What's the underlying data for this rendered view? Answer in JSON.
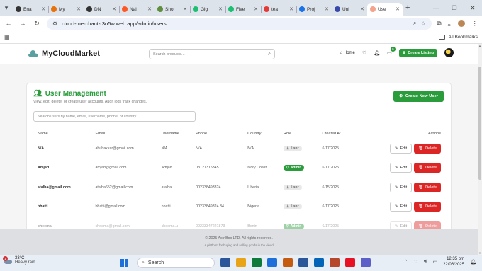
{
  "browser": {
    "tabs": [
      {
        "label": "Ena",
        "color": "#333333"
      },
      {
        "label": "My",
        "color": "#e8710a"
      },
      {
        "label": "DN",
        "color": "#333333"
      },
      {
        "label": "Nai",
        "color": "#ff5722"
      },
      {
        "label": "Sho",
        "color": "#5e8e3e"
      },
      {
        "label": "Gig",
        "color": "#1dbf73"
      },
      {
        "label": "Five",
        "color": "#1dbf73"
      },
      {
        "label": "tea",
        "color": "#e53935"
      },
      {
        "label": "Proj",
        "color": "#1a73e8"
      },
      {
        "label": "Uni",
        "color": "#3949ab"
      },
      {
        "label": "Use",
        "color": "#f4a38c"
      }
    ],
    "url": "cloud-merchant-r3o5w.web.app/admin/users",
    "all_bookmarks": "All Bookmarks"
  },
  "app": {
    "brand": "MyCloudMarket",
    "search_placeholder": "Search products...",
    "home": "Home",
    "cart_count": "0",
    "create_listing": "Create Listing"
  },
  "card": {
    "title": "User Management",
    "subtitle": "View, edit, delete, or create user accounts. Audit logs track changes.",
    "new_user_button": "Create New User",
    "search_placeholder": "Search users by name, email, username, phone, or country..."
  },
  "table": {
    "columns": [
      "Name",
      "Email",
      "Username",
      "Phone",
      "Country",
      "Role",
      "Created At",
      "Actions"
    ],
    "rows": [
      {
        "name": "N/A",
        "email": "abubakkar@gmail.com",
        "username": "N/A",
        "phone": "N/A",
        "country": "N/A",
        "role": "User",
        "created": "6/17/2025"
      },
      {
        "name": "Amjad",
        "email": "amjad@gmail.com",
        "username": "Amjad",
        "phone": "03127315345",
        "country": "Ivory Coast",
        "role": "Admin",
        "created": "6/17/2025"
      },
      {
        "name": "atalha@gmail.com",
        "email": "atalha652@gmail.com",
        "username": "atalha",
        "phone": "002338493324",
        "country": "Liberia",
        "role": "User",
        "created": "6/15/2025"
      },
      {
        "name": "bhatti",
        "email": "bhatti@gmail.com",
        "username": "bhatti",
        "phone": "00233849324 34",
        "country": "Nigeria",
        "role": "User",
        "created": "6/17/2025"
      },
      {
        "name": "cheema",
        "email": "cheema@gmail.com",
        "username": "cheema.u",
        "phone": "00233347221873",
        "country": "Benin",
        "role": "Admin",
        "created": "6/17/2025"
      }
    ],
    "edit_label": "Edit",
    "delete_label": "Delete"
  },
  "footer": {
    "copyright": "© 2025 AstriBox LTD. All rights reserved.",
    "tagline": "A platform for buying and selling goods in the cloud"
  },
  "taskbar": {
    "temp": "33°C",
    "weather": "Heavy rain",
    "weather_badge": "1",
    "search": "Search",
    "time": "12:35 pm",
    "date": "22/06/2025",
    "app_colors": [
      "#2b579a",
      "#e8a317",
      "#0f7b3a",
      "#1e6fd9",
      "#c55a11",
      "#2b579a",
      "#0364b8",
      "#b7472a",
      "#e81123",
      "#5b5fc7"
    ]
  }
}
